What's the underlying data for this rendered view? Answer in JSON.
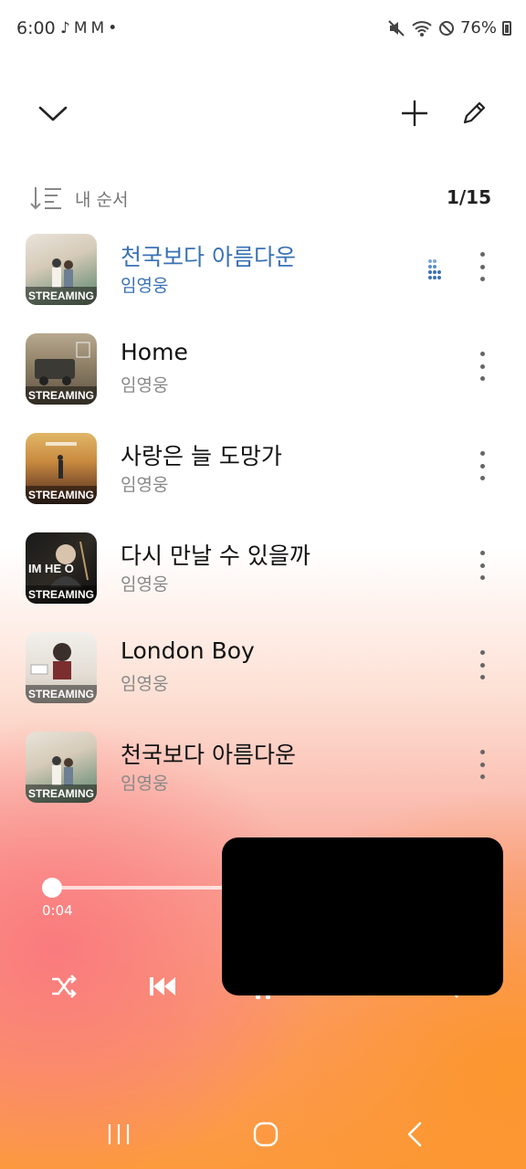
{
  "status_bar": {
    "time": "6:00",
    "battery": "76%",
    "left_icons": [
      "music-note-icon",
      "gmail-icon",
      "gmail-icon",
      "dot-icon"
    ],
    "right_icons": [
      "mute-icon",
      "wifi-icon",
      "do-not-disturb-icon",
      "battery-icon"
    ]
  },
  "top_bar": {
    "icons": [
      "chevron-down-icon",
      "add-icon",
      "edit-icon"
    ]
  },
  "queue": {
    "sort_label": "내 순서",
    "count": "1/15"
  },
  "tracks": [
    {
      "title": "천국보다 아름다운",
      "artist": "임영웅",
      "badge": "STREAMING",
      "active": true
    },
    {
      "title": "Home",
      "artist": "임영웅",
      "badge": "STREAMING",
      "active": false
    },
    {
      "title": "사랑은 늘 도망가",
      "artist": "임영웅",
      "badge": "STREAMING",
      "active": false
    },
    {
      "title": "다시 만날 수 있을까",
      "artist": "임영웅",
      "badge": "STREAMING",
      "active": false
    },
    {
      "title": "London Boy",
      "artist": "임영웅",
      "badge": "STREAMING",
      "active": false
    },
    {
      "title": "천국보다 아름다운",
      "artist": "임영웅",
      "badge": "STREAMING",
      "active": false
    }
  ],
  "player": {
    "elapsed": "0:04",
    "progress_fraction": 0.02,
    "controls": [
      "shuffle-icon",
      "previous-icon",
      "play-pause-icon",
      "repeat-icon"
    ]
  },
  "colors": {
    "accent": "#3a72b4",
    "gradient_pink": "#f98a86",
    "gradient_orange": "#fc9a3c"
  },
  "nav_bar": {
    "icons": [
      "recent-apps-icon",
      "home-icon",
      "back-icon"
    ]
  }
}
